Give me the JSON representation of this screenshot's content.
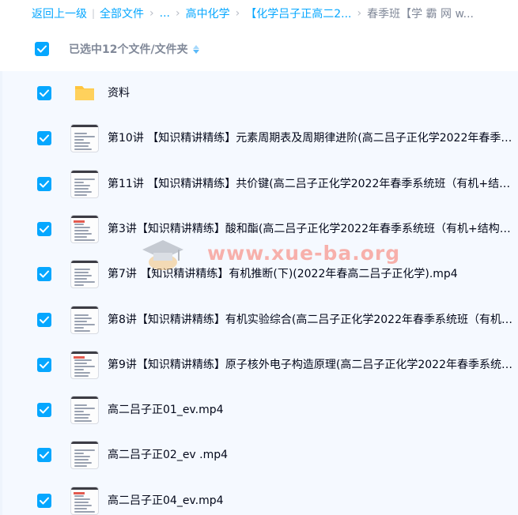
{
  "breadcrumb": {
    "back": "返回上一级",
    "all_files": "全部文件",
    "ellipsis": "...",
    "high_chem": "高中化学",
    "course": "【化学吕子正高二2...",
    "current": "春季班【学 霸 网 w..."
  },
  "header": {
    "selected_label": "已选中12个文件/文件夹"
  },
  "files": [
    {
      "name": "资料",
      "type": "folder",
      "checked": true
    },
    {
      "name": "第10讲 【知识精讲精练】元素周期表及周期律进阶(高二吕子正化学2022年春季系...",
      "type": "video",
      "checked": true
    },
    {
      "name": "第11讲 【知识精讲精练】共价键(高二吕子正化学2022年春季系统班（有机+结构)....",
      "type": "video",
      "checked": true
    },
    {
      "name": "第3讲【知识精讲精练】酸和酯(高二吕子正化学2022年春季系统班（有机+结构))_e...",
      "type": "video",
      "checked": true
    },
    {
      "name": "第7讲 【知识精讲精练】有机推断(下)(2022年春高二吕子正化学).mp4",
      "type": "video",
      "checked": true
    },
    {
      "name": "第8讲【知识精讲精练】有机实验综合(高二吕子正化学2022年春季系统班（有机+...",
      "type": "video",
      "checked": true
    },
    {
      "name": "第9讲【知识精讲精练】原子核外电子构造原理(高二吕子正化学2022年春季系统班...",
      "type": "video",
      "checked": true
    },
    {
      "name": "高二吕子正01_ev.mp4",
      "type": "video",
      "checked": true
    },
    {
      "name": "高二吕子正02_ev .mp4",
      "type": "video",
      "checked": true
    },
    {
      "name": "高二吕子正04_ev.mp4",
      "type": "video",
      "checked": true
    }
  ],
  "watermark": {
    "text": "www.xue-ba.org"
  },
  "colors": {
    "accent": "#06a7ff",
    "list_bg": "#f5f9ff",
    "folder": "#ffc53d",
    "watermark": "#f7b0ab"
  },
  "icons": {
    "checkbox": "checkmark-icon",
    "folder": "folder-icon",
    "video_thumbnail": "video-thumbnail",
    "sort": "sort-icon",
    "watermark_logo": "graduation-cap-icon"
  }
}
